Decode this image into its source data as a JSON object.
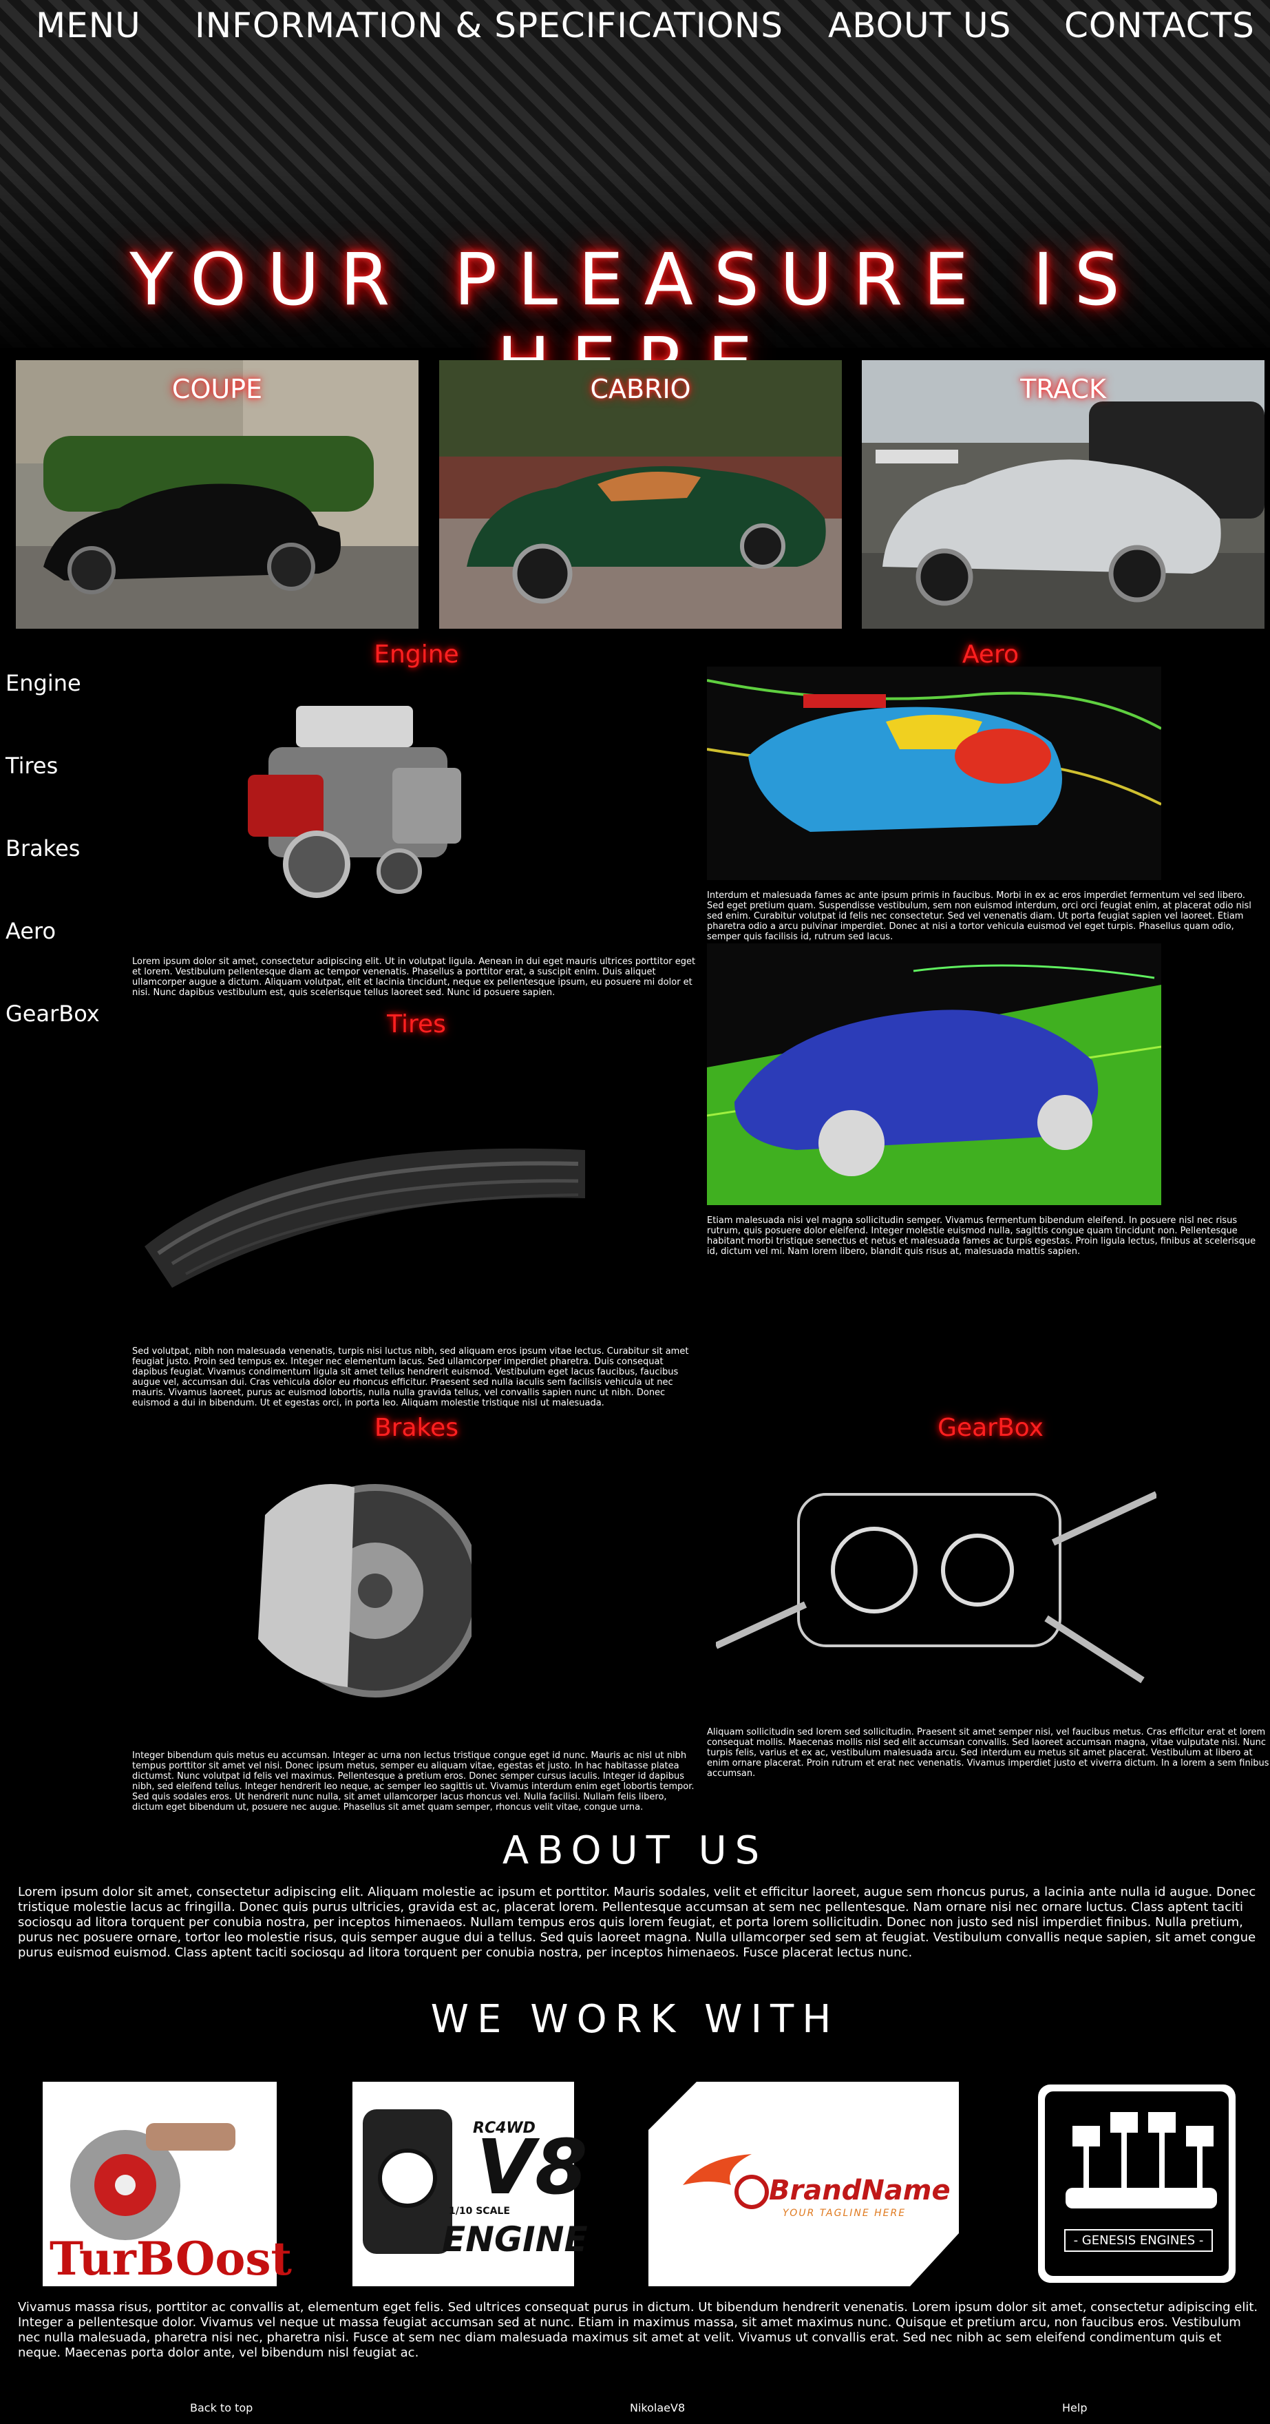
{
  "nav": {
    "menu": "MENU",
    "info": "INFORMATION & SPECIFICATIONS",
    "about": "ABOUT US",
    "contacts": "CONTACTS"
  },
  "hero": {
    "title": "YOUR PLEASURE IS HERE"
  },
  "cards": [
    {
      "label": "COUPE"
    },
    {
      "label": "CABRIO"
    },
    {
      "label": "TRACK"
    }
  ],
  "sidebar": {
    "items": [
      {
        "label": "Engine"
      },
      {
        "label": "Tires"
      },
      {
        "label": "Brakes"
      },
      {
        "label": "Aero"
      },
      {
        "label": "GearBox"
      }
    ]
  },
  "sections": {
    "engine": {
      "title": "Engine",
      "text": "Lorem ipsum dolor sit amet, consectetur adipiscing elit. Ut in volutpat ligula. Aenean in dui eget mauris ultrices porttitor eget et lorem. Vestibulum pellentesque diam ac tempor venenatis. Phasellus a porttitor erat, a suscipit enim. Duis aliquet ullamcorper augue a dictum. Aliquam volutpat, elit et lacinia tincidunt, neque ex pellentesque ipsum, eu posuere mi dolor et nisi. Nunc dapibus vestibulum est, quis scelerisque tellus laoreet sed. Nunc id posuere sapien."
    },
    "aero": {
      "title": "Aero",
      "text1": "Interdum et malesuada fames ac ante ipsum primis in faucibus. Morbi in ex ac eros imperdiet fermentum vel sed libero. Sed eget pretium quam. Suspendisse vestibulum, sem non euismod interdum, orci orci feugiat enim, at placerat odio nisl sed enim. Curabitur volutpat id felis nec consectetur. Sed vel venenatis diam. Ut porta feugiat sapien vel laoreet. Etiam pharetra odio a arcu pulvinar imperdiet. Donec at nisi a tortor vehicula euismod vel eget turpis. Phasellus quam odio, semper quis facilisis id, rutrum sed lacus.",
      "text2": "Etiam malesuada nisi vel magna sollicitudin semper. Vivamus fermentum bibendum eleifend. In posuere nisl nec risus rutrum, quis posuere dolor eleifend. Integer molestie euismod nulla, sagittis congue quam tincidunt non. Pellentesque habitant morbi tristique senectus et netus et malesuada fames ac turpis egestas. Proin ligula lectus, finibus at scelerisque id, dictum vel mi. Nam lorem libero, blandit quis risus at, malesuada mattis sapien."
    },
    "tires": {
      "title": "Tires",
      "text": "Sed volutpat, nibh non malesuada venenatis, turpis nisi luctus nibh, sed aliquam eros ipsum vitae lectus. Curabitur sit amet feugiat justo. Proin sed tempus ex. Integer nec elementum lacus. Sed ullamcorper imperdiet pharetra. Duis consequat dapibus feugiat. Vivamus condimentum ligula sit amet tellus hendrerit euismod. Vestibulum eget lacus faucibus, faucibus augue vel, accumsan dui. Cras vehicula dolor eu rhoncus efficitur. Praesent sed nulla iaculis sem facilisis vehicula ut nec mauris. Vivamus laoreet, purus ac euismod lobortis, nulla nulla gravida tellus, vel convallis sapien nunc ut nibh. Donec euismod a dui in bibendum. Ut et egestas orci, in porta leo. Aliquam molestie tristique nisl ut malesuada."
    },
    "brakes": {
      "title": "Brakes",
      "text": "Integer bibendum quis metus eu accumsan. Integer ac urna non lectus tristique congue eget id nunc. Mauris ac nisl ut nibh tempus porttitor sit amet vel nisi. Donec ipsum metus, semper eu aliquam vitae, egestas et justo. In hac habitasse platea dictumst. Nunc volutpat id felis vel maximus. Pellentesque a pretium eros. Donec semper cursus iaculis. Integer id dapibus nibh, sed eleifend tellus. Integer hendrerit leo neque, ac semper leo sagittis ut. Vivamus interdum enim eget lobortis tempor. Sed quis sodales eros. Ut hendrerit nunc nulla, sit amet ullamcorper lacus rhoncus vel. Nulla facilisi. Nullam felis libero, dictum eget bibendum ut, posuere nec augue. Phasellus sit amet quam semper, rhoncus velit vitae, congue urna."
    },
    "gearbox": {
      "title": "GearBox",
      "text": "Aliquam sollicitudin sed lorem sed sollicitudin. Praesent sit amet semper nisi, vel faucibus metus. Cras efficitur erat et lorem consequat mollis. Maecenas mollis nisl sed elit accumsan convallis. Sed laoreet accumsan magna, vitae vulputate nisi. Nunc turpis felis, varius et ex ac, vestibulum malesuada arcu. Sed interdum eu metus sit amet placerat. Vestibulum at libero at enim ornare placerat. Proin rutrum et erat nec venenatis. Vivamus imperdiet justo et viverra dictum. In a lorem a sem finibus accumsan."
    }
  },
  "about": {
    "title": "ABOUT US",
    "text": "Lorem ipsum dolor sit amet, consectetur adipiscing elit. Aliquam molestie ac ipsum et porttitor. Mauris sodales, velit et efficitur laoreet, augue sem rhoncus purus, a lacinia ante nulla id augue. Donec tristique molestie lacus ac fringilla. Donec quis purus ultricies, gravida est ac, placerat lorem. Pellentesque accumsan at sem nec pellentesque. Nam ornare nisi nec ornare luctus. Class aptent taciti sociosqu ad litora torquent per conubia nostra, per inceptos himenaeos. Nullam tempus eros quis lorem feugiat, et porta lorem sollicitudin. Donec non justo sed nisl imperdiet finibus. Nulla pretium, purus nec posuere ornare, tortor leo molestie risus, quis semper augue dui a tellus. Sed quis laoreet magna. Nulla ullamcorper sed sem at feugiat. Vestibulum convallis neque sapien, sit amet congue purus euismod euismod. Class aptent taciti sociosqu ad litora torquent per conubia nostra, per inceptos himenaeos. Fusce placerat lectus nunc."
  },
  "partners": {
    "title": "WE WORK WITH",
    "turboost": "TurBOost",
    "v8_top": "RC4WD",
    "v8_big": "V8",
    "v8_scale": "1/10 SCALE",
    "v8_engine": "ENGINE",
    "brand": "BrandName",
    "tagline": "YOUR TAGLINE HERE",
    "genesis": "- GENESIS ENGINES -",
    "text": "Vivamus massa risus, porttitor ac convallis at, elementum eget felis. Sed ultrices consequat purus in dictum. Ut bibendum hendrerit venenatis. Lorem ipsum dolor sit amet, consectetur adipiscing elit. Integer a pellentesque dolor. Vivamus vel neque ut massa feugiat accumsan sed at nunc. Etiam in maximus massa, sit amet maximus nunc. Quisque et pretium arcu, non faucibus eros. Vestibulum nec nulla malesuada, pharetra nisi nec, pharetra nisi. Fusce at sem nec diam malesuada maximus sit amet at velit. Vivamus ut convallis erat. Sed nec nibh ac sem eleifend condimentum quis et neque. Maecenas porta dolor ante, vel bibendum nisl feugiat ac."
  },
  "footer": {
    "back": "Back to top",
    "author": "NikolaeV8",
    "help": "Help"
  }
}
